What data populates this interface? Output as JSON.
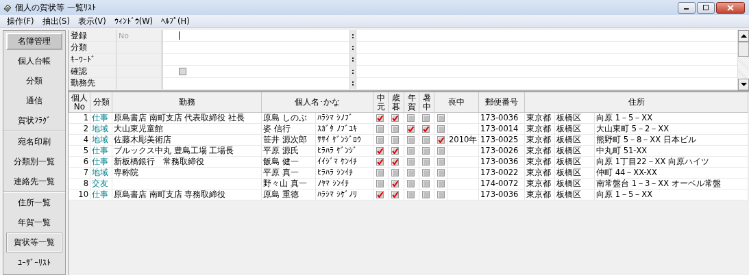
{
  "window": {
    "title": "個人の賀状等 一覧ﾘｽﾄ"
  },
  "menu": [
    "操作(F)",
    "抽出(S)",
    "表示(V)",
    "ｳｨﾝﾄﾞｳ(W)",
    "ﾍﾙﾌﾟ(H)"
  ],
  "sidebar": {
    "groups": [
      {
        "items": [
          {
            "label": "名簿管理",
            "selected": true,
            "outlined": false
          },
          {
            "label": "個人台帳",
            "selected": false,
            "outlined": false
          },
          {
            "label": "分類",
            "selected": false,
            "outlined": false
          },
          {
            "label": "通信",
            "selected": false,
            "outlined": false
          },
          {
            "label": "賀状ﾌﾗｸﾞ",
            "selected": false,
            "outlined": false
          }
        ]
      },
      {
        "items": [
          {
            "label": "宛名印刷",
            "selected": false,
            "outlined": false
          },
          {
            "label": "分類別一覧",
            "selected": false,
            "outlined": false
          },
          {
            "label": "連絡先一覧",
            "selected": false,
            "outlined": false
          }
        ]
      },
      {
        "items": [
          {
            "label": "住所一覧",
            "selected": false,
            "outlined": false
          },
          {
            "label": "年賀一覧",
            "selected": false,
            "outlined": false
          },
          {
            "label": "賀状等一覧",
            "selected": false,
            "outlined": true
          },
          {
            "label": "ﾕｰｻﾞｰﾘｽﾄ",
            "selected": false,
            "outlined": false
          }
        ]
      }
    ]
  },
  "form": {
    "rows": [
      {
        "label": "登録",
        "placeholder": "No",
        "kind": "text"
      },
      {
        "label": "分類",
        "kind": "plain"
      },
      {
        "label": "ｷｰﾜｰﾄﾞ",
        "kind": "plain"
      },
      {
        "label": "確認",
        "kind": "check",
        "checked": false
      },
      {
        "label": "勤務先",
        "kind": "plain"
      }
    ],
    "separator": ":"
  },
  "table": {
    "columns": [
      "個人No",
      "分類",
      "勤務",
      "個人名･かな",
      "中元",
      "歳暮",
      "年賀",
      "暑中",
      "喪中",
      "郵便番号",
      "住所"
    ],
    "rows": [
      {
        "no": "1",
        "category": "仕事",
        "work": "原島書店 南町支店 代表取締役 社長",
        "name": "原島 しのぶ",
        "kana": "ﾊﾗｼﾏ ｼﾉﾌﾞ",
        "chugen": true,
        "seibo": true,
        "nenga": false,
        "shochu": false,
        "mochu": false,
        "zip": "173-0036",
        "pref": "東京都",
        "ward": "板橋区",
        "street": "向原 1－5－XX"
      },
      {
        "no": "2",
        "category": "地域",
        "work": "大山東児童館",
        "name": "姿 信行",
        "kana": "ｽｶﾞﾀ ﾉﾌﾞﾕｷ",
        "chugen": false,
        "seibo": false,
        "nenga": true,
        "shochu": true,
        "mochu": false,
        "zip": "173-0014",
        "pref": "東京都",
        "ward": "板橋区",
        "street": "大山東町 5－2－XX"
      },
      {
        "no": "4",
        "category": "地域",
        "work": "佐藤木彫美術店",
        "name": "笹井 源次郎",
        "kana": "ｻｻｲ ｹﾞﾝｼﾞﾛｳ",
        "chugen": false,
        "seibo": false,
        "nenga": false,
        "shochu": false,
        "mochu": true,
        "mochu_year": "2010年",
        "zip": "173-0025",
        "pref": "東京都",
        "ward": "板橋区",
        "street": "熊野町 5－8－XX  日本ビル"
      },
      {
        "no": "5",
        "category": "仕事",
        "work": "ブルックス中丸 豊島工場 工場長",
        "name": "平原 源氏",
        "kana": "ﾋﾗﾊﾗ ｹﾞﾝｼﾞ",
        "chugen": true,
        "seibo": true,
        "nenga": false,
        "shochu": false,
        "mochu": false,
        "zip": "173-0026",
        "pref": "東京都",
        "ward": "板橋区",
        "street": "中丸町 51-XX"
      },
      {
        "no": "6",
        "category": "仕事",
        "work": "新板橋銀行　常務取締役",
        "name": "飯島 健一",
        "kana": "ｲｲｼﾞﾏ ｹﾝｲﾁ",
        "chugen": true,
        "seibo": true,
        "nenga": false,
        "shochu": false,
        "mochu": false,
        "zip": "173-0036",
        "pref": "東京都",
        "ward": "板橋区",
        "street": "向原 1丁目22－XX  向原ハイツ"
      },
      {
        "no": "7",
        "category": "地域",
        "work": "専称院",
        "name": "平原 真一",
        "kana": "ﾋﾗﾊﾗ ｼﾝｲﾁ",
        "chugen": false,
        "seibo": false,
        "nenga": false,
        "shochu": false,
        "mochu": false,
        "zip": "173-0022",
        "pref": "東京都",
        "ward": "板橋区",
        "street": "仲町 44－XX-XX"
      },
      {
        "no": "8",
        "category": "交友",
        "name": "野々山 真一",
        "kana": "ﾉﾔﾏ ｼﾝｲﾁ",
        "chugen": false,
        "seibo": true,
        "nenga": false,
        "shochu": false,
        "mochu": false,
        "zip": "174-0072",
        "pref": "東京都",
        "ward": "板橋区",
        "street": "南常盤台 1－3－XX  オーベル常盤"
      },
      {
        "no": "10",
        "category": "仕事",
        "work": "原島書店 南町支店 専務取締役",
        "name": "原島 重徳",
        "kana": "ﾊﾗｼﾏ ｼｹﾞﾉﾘ",
        "chugen": true,
        "seibo": true,
        "nenga": false,
        "shochu": false,
        "mochu": false,
        "zip": "173-0036",
        "pref": "東京都",
        "ward": "板橋区",
        "street": "向原 1－5－XX"
      }
    ]
  }
}
